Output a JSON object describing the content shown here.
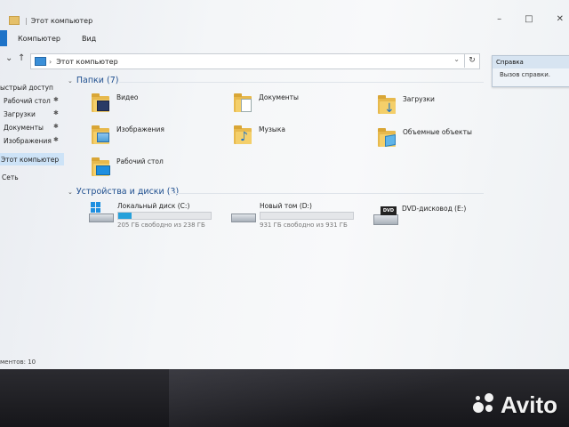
{
  "window": {
    "title": "Этот компьютер"
  },
  "ribbon": {
    "tabs": [
      "Компьютер",
      "Вид"
    ]
  },
  "address": {
    "crumb": "Этот компьютер"
  },
  "help_tooltip": {
    "title": "Справка",
    "subtitle": "Вызов справки."
  },
  "sidebar": {
    "quick_access": "ыстрый доступ",
    "items": [
      "Рабочий стол",
      "Загрузки",
      "Документы",
      "Изображения"
    ],
    "this_pc": "Этот компьютер",
    "network": "Сеть"
  },
  "folders": {
    "header": "Папки (7)",
    "items": [
      "Видео",
      "Документы",
      "Загрузки",
      "Изображения",
      "Музыка",
      "Объемные объекты",
      "Рабочий стол"
    ]
  },
  "drives": {
    "header": "Устройства и диски (3)",
    "items": [
      {
        "name": "Локальный диск (C:)",
        "free": "205 ГБ свободно из 238 ГБ",
        "used_fraction": 0.14
      },
      {
        "name": "Новый том (D:)",
        "free": "931 ГБ свободно из 931 ГБ",
        "used_fraction": 0.0
      },
      {
        "name": "DVD-дисковод (E:)"
      }
    ]
  },
  "statusbar": {
    "text": "ментов: 10"
  },
  "watermark": {
    "text": "Avito"
  },
  "colors": {
    "accent": "#1e73c8",
    "drive_bar": "#26a0da",
    "folder": "#f4cf6a"
  },
  "icons": {
    "folder": "folder-icon",
    "drive": "hard-drive-icon",
    "dvd": "dvd-drive-icon",
    "pc": "computer-icon"
  }
}
